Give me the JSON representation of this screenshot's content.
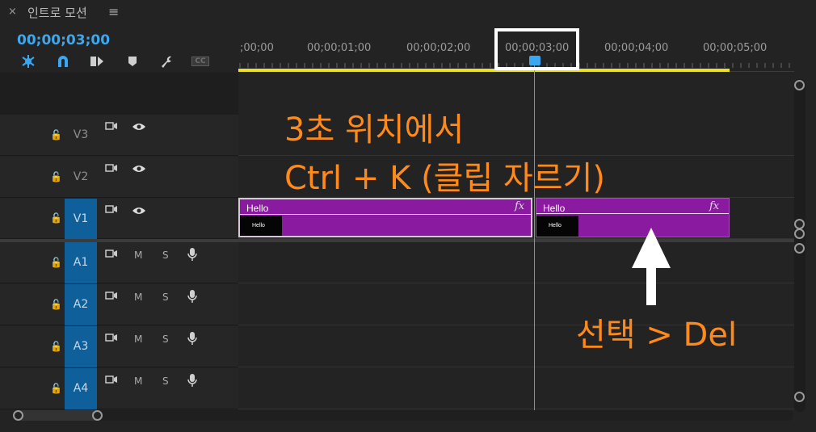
{
  "panel": {
    "close_glyph": "×",
    "sequence_name": "인트로 모션",
    "menu_glyph": "≡",
    "timecode": "00;00;03;00"
  },
  "tools": [
    "snap-icon",
    "magnet-icon",
    "linked-selection-icon",
    "marker-icon",
    "wrench-icon",
    "captions-icon"
  ],
  "tool_cc_label": "CC",
  "ruler": {
    "labels": [
      ";00;00",
      "00;00;01;00",
      "00;00;02;00",
      "00;00;03;00",
      "00;00;04;00",
      "00;00;05;00"
    ]
  },
  "video_tracks": [
    {
      "id": "V3",
      "selected": false
    },
    {
      "id": "V2",
      "selected": false
    },
    {
      "id": "V1",
      "selected": true
    }
  ],
  "audio_tracks": [
    {
      "id": "A1",
      "m": "M",
      "s": "S"
    },
    {
      "id": "A2",
      "m": "M",
      "s": "S"
    },
    {
      "id": "A3",
      "m": "M",
      "s": "S"
    },
    {
      "id": "A4",
      "m": "M",
      "s": "S"
    }
  ],
  "clips": [
    {
      "label": "Hello",
      "fx": "fx",
      "thumb_text": "Hello"
    },
    {
      "label": "Hello",
      "fx": "fx",
      "thumb_text": "Hello"
    }
  ],
  "annotations": {
    "line1": "3초 위치에서",
    "line2": "Ctrl + K (클립 자르기)",
    "line3": "선택 > Del"
  },
  "colors": {
    "accent_blue": "#3aa7f0",
    "clip_purple": "#8a1ba0",
    "annotation_orange": "#ff8a1a",
    "work_area_yellow": "#e9e12a"
  }
}
